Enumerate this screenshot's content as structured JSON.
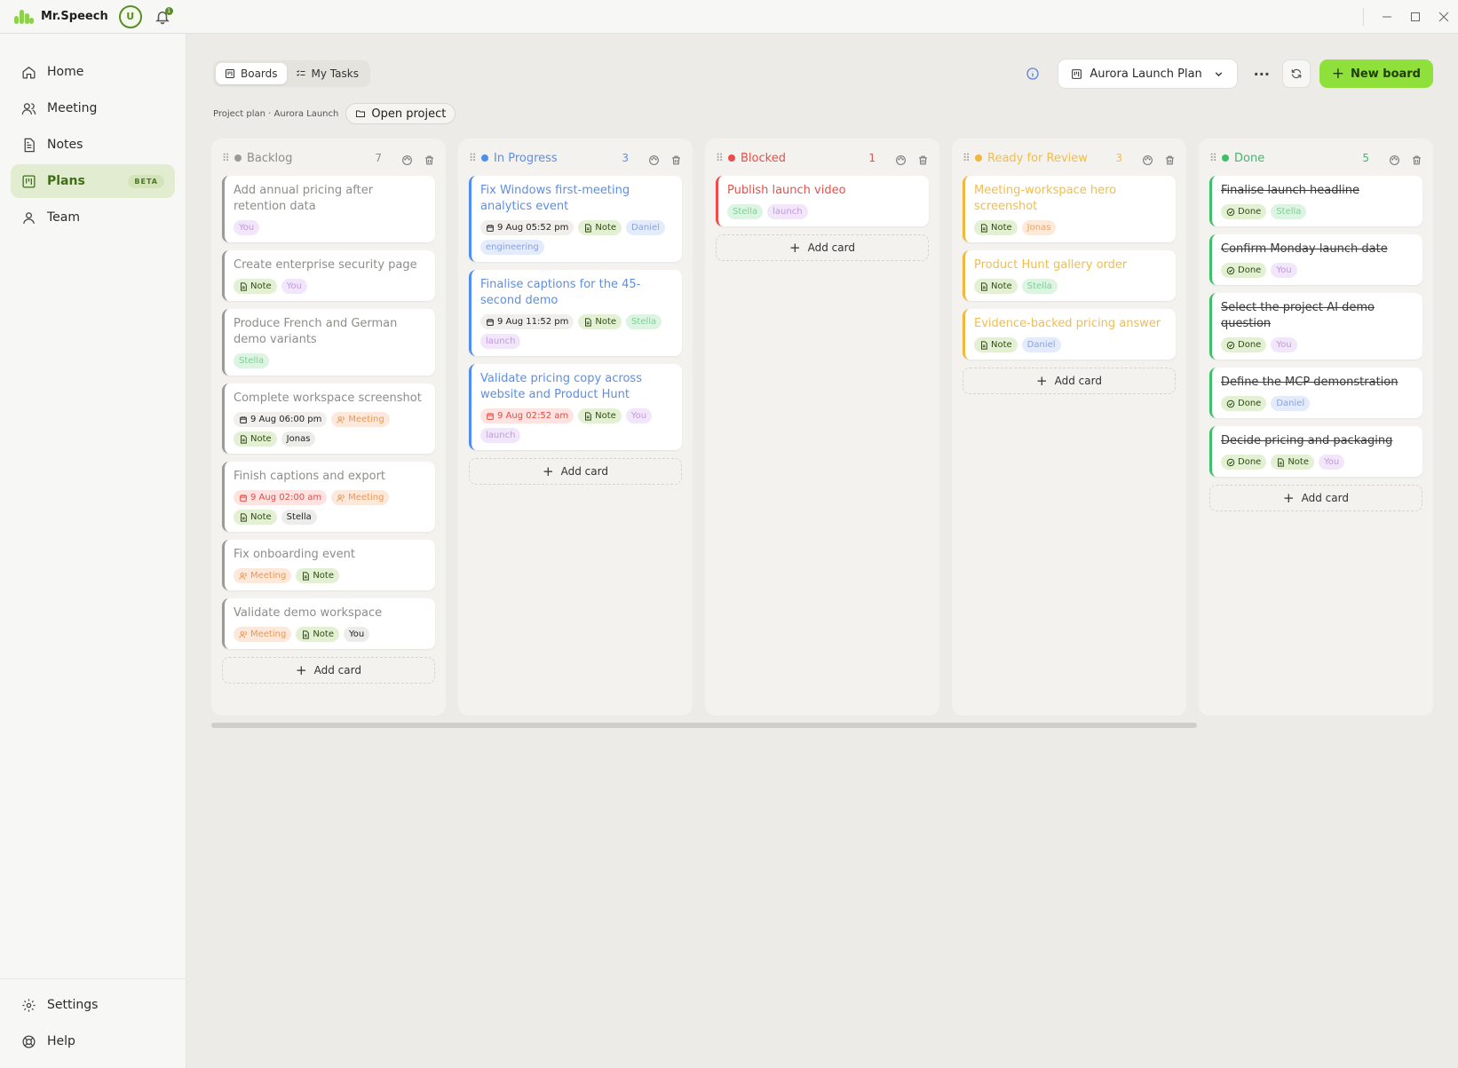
{
  "app": {
    "name": "Mr.Speech",
    "avatar_initial": "U",
    "notification_count": "1",
    "brand_color": "#8ed14a"
  },
  "sidebar": {
    "items": [
      {
        "label": "Home",
        "icon": "home-icon"
      },
      {
        "label": "Meeting",
        "icon": "users-icon"
      },
      {
        "label": "Notes",
        "icon": "document-icon"
      },
      {
        "label": "Plans",
        "icon": "board-icon",
        "badge": "BETA",
        "active": true
      },
      {
        "label": "Team",
        "icon": "user-icon"
      }
    ],
    "bottom": [
      {
        "label": "Settings",
        "icon": "gear-icon"
      },
      {
        "label": "Help",
        "icon": "lifebuoy-icon"
      }
    ]
  },
  "toolbar": {
    "tabs": [
      {
        "label": "Boards",
        "active": true
      },
      {
        "label": "My Tasks",
        "active": false
      }
    ],
    "board_select": "Aurora Launch Plan",
    "more": "···",
    "new_board": "New board"
  },
  "breadcrumb": {
    "text": "Project plan · Aurora Launch",
    "open_project": "Open project"
  },
  "add_card_label": "Add card",
  "columns": [
    {
      "title": "Backlog",
      "count": "7",
      "color": "#9a9a96",
      "title_color": "#8d8d89",
      "cards": [
        {
          "title": "Add annual pricing after retention data",
          "tags": [
            {
              "t": "purple",
              "label": "You"
            }
          ]
        },
        {
          "title": "Create enterprise security page",
          "tags": [
            {
              "t": "note",
              "label": "Note"
            },
            {
              "t": "purple",
              "label": "You"
            }
          ]
        },
        {
          "title": "Produce French and German demo variants",
          "tags": [
            {
              "t": "green",
              "label": "Stella"
            }
          ]
        },
        {
          "title": "Complete workspace screenshot",
          "tags": [
            {
              "t": "date",
              "label": "9 Aug 06:00 pm"
            },
            {
              "t": "meeting",
              "label": "Meeting"
            },
            {
              "t": "note",
              "label": "Note"
            },
            {
              "t": "gray",
              "label": "Jonas"
            }
          ]
        },
        {
          "title": "Finish captions and export",
          "tags": [
            {
              "t": "date-red",
              "label": "9 Aug 02:00 am"
            },
            {
              "t": "meeting",
              "label": "Meeting"
            },
            {
              "t": "note",
              "label": "Note"
            },
            {
              "t": "gray",
              "label": "Stella"
            }
          ]
        },
        {
          "title": "Fix onboarding event",
          "tags": [
            {
              "t": "meeting",
              "label": "Meeting"
            },
            {
              "t": "note",
              "label": "Note"
            }
          ]
        },
        {
          "title": "Validate demo workspace",
          "tags": [
            {
              "t": "meeting",
              "label": "Meeting"
            },
            {
              "t": "note",
              "label": "Note"
            },
            {
              "t": "gray",
              "label": "You"
            }
          ]
        }
      ]
    },
    {
      "title": "In Progress",
      "count": "3",
      "color": "#4f8ef0",
      "title_color": "#5b8ee6",
      "cards": [
        {
          "title": "Fix Windows first-meeting analytics event",
          "tags": [
            {
              "t": "date",
              "label": "9 Aug 05:52 pm"
            },
            {
              "t": "note",
              "label": "Note"
            },
            {
              "t": "blue",
              "label": "Daniel"
            },
            {
              "t": "blue",
              "label": "engineering"
            }
          ]
        },
        {
          "title": "Finalise captions for the 45-second demo",
          "tags": [
            {
              "t": "date",
              "label": "9 Aug 11:52 pm"
            },
            {
              "t": "note",
              "label": "Note"
            },
            {
              "t": "green",
              "label": "Stella"
            },
            {
              "t": "purple",
              "label": "launch"
            }
          ]
        },
        {
          "title": "Validate pricing copy across website and Product Hunt",
          "tags": [
            {
              "t": "date-red",
              "label": "9 Aug 02:52 am"
            },
            {
              "t": "note",
              "label": "Note"
            },
            {
              "t": "purple",
              "label": "You"
            },
            {
              "t": "purple",
              "label": "launch"
            }
          ]
        }
      ]
    },
    {
      "title": "Blocked",
      "count": "1",
      "color": "#ef4b4b",
      "title_color": "#e5504c",
      "cards": [
        {
          "title": "Publish launch video",
          "tags": [
            {
              "t": "green",
              "label": "Stella"
            },
            {
              "t": "purple",
              "label": "launch"
            }
          ]
        }
      ]
    },
    {
      "title": "Ready for Review",
      "count": "3",
      "color": "#f2b739",
      "title_color": "#f0bd4f",
      "cards": [
        {
          "title": "Meeting-workspace hero screenshot",
          "tags": [
            {
              "t": "note",
              "label": "Note"
            },
            {
              "t": "orange",
              "label": "Jonas"
            }
          ]
        },
        {
          "title": "Product Hunt gallery order",
          "tags": [
            {
              "t": "note",
              "label": "Note"
            },
            {
              "t": "green",
              "label": "Stella"
            }
          ]
        },
        {
          "title": "Evidence-backed pricing answer",
          "tags": [
            {
              "t": "note",
              "label": "Note"
            },
            {
              "t": "blue",
              "label": "Daniel"
            }
          ]
        }
      ]
    },
    {
      "title": "Done",
      "count": "5",
      "color": "#3fbf6a",
      "title_color": "#48b36c",
      "cards": [
        {
          "title": "Finalise launch headline",
          "done": true,
          "tags": [
            {
              "t": "done",
              "label": "Done"
            },
            {
              "t": "green",
              "label": "Stella"
            }
          ]
        },
        {
          "title": "Confirm Monday launch date",
          "done": true,
          "tags": [
            {
              "t": "done",
              "label": "Done"
            },
            {
              "t": "purple",
              "label": "You"
            }
          ]
        },
        {
          "title": "Select the project-AI demo question",
          "done": true,
          "tags": [
            {
              "t": "done",
              "label": "Done"
            },
            {
              "t": "purple",
              "label": "You"
            }
          ]
        },
        {
          "title": "Define the MCP demonstration",
          "done": true,
          "tags": [
            {
              "t": "done",
              "label": "Done"
            },
            {
              "t": "blue",
              "label": "Daniel"
            }
          ]
        },
        {
          "title": "Decide pricing and packaging",
          "done": true,
          "tags": [
            {
              "t": "done",
              "label": "Done"
            },
            {
              "t": "note",
              "label": "Note"
            },
            {
              "t": "purple",
              "label": "You"
            }
          ]
        }
      ]
    }
  ]
}
